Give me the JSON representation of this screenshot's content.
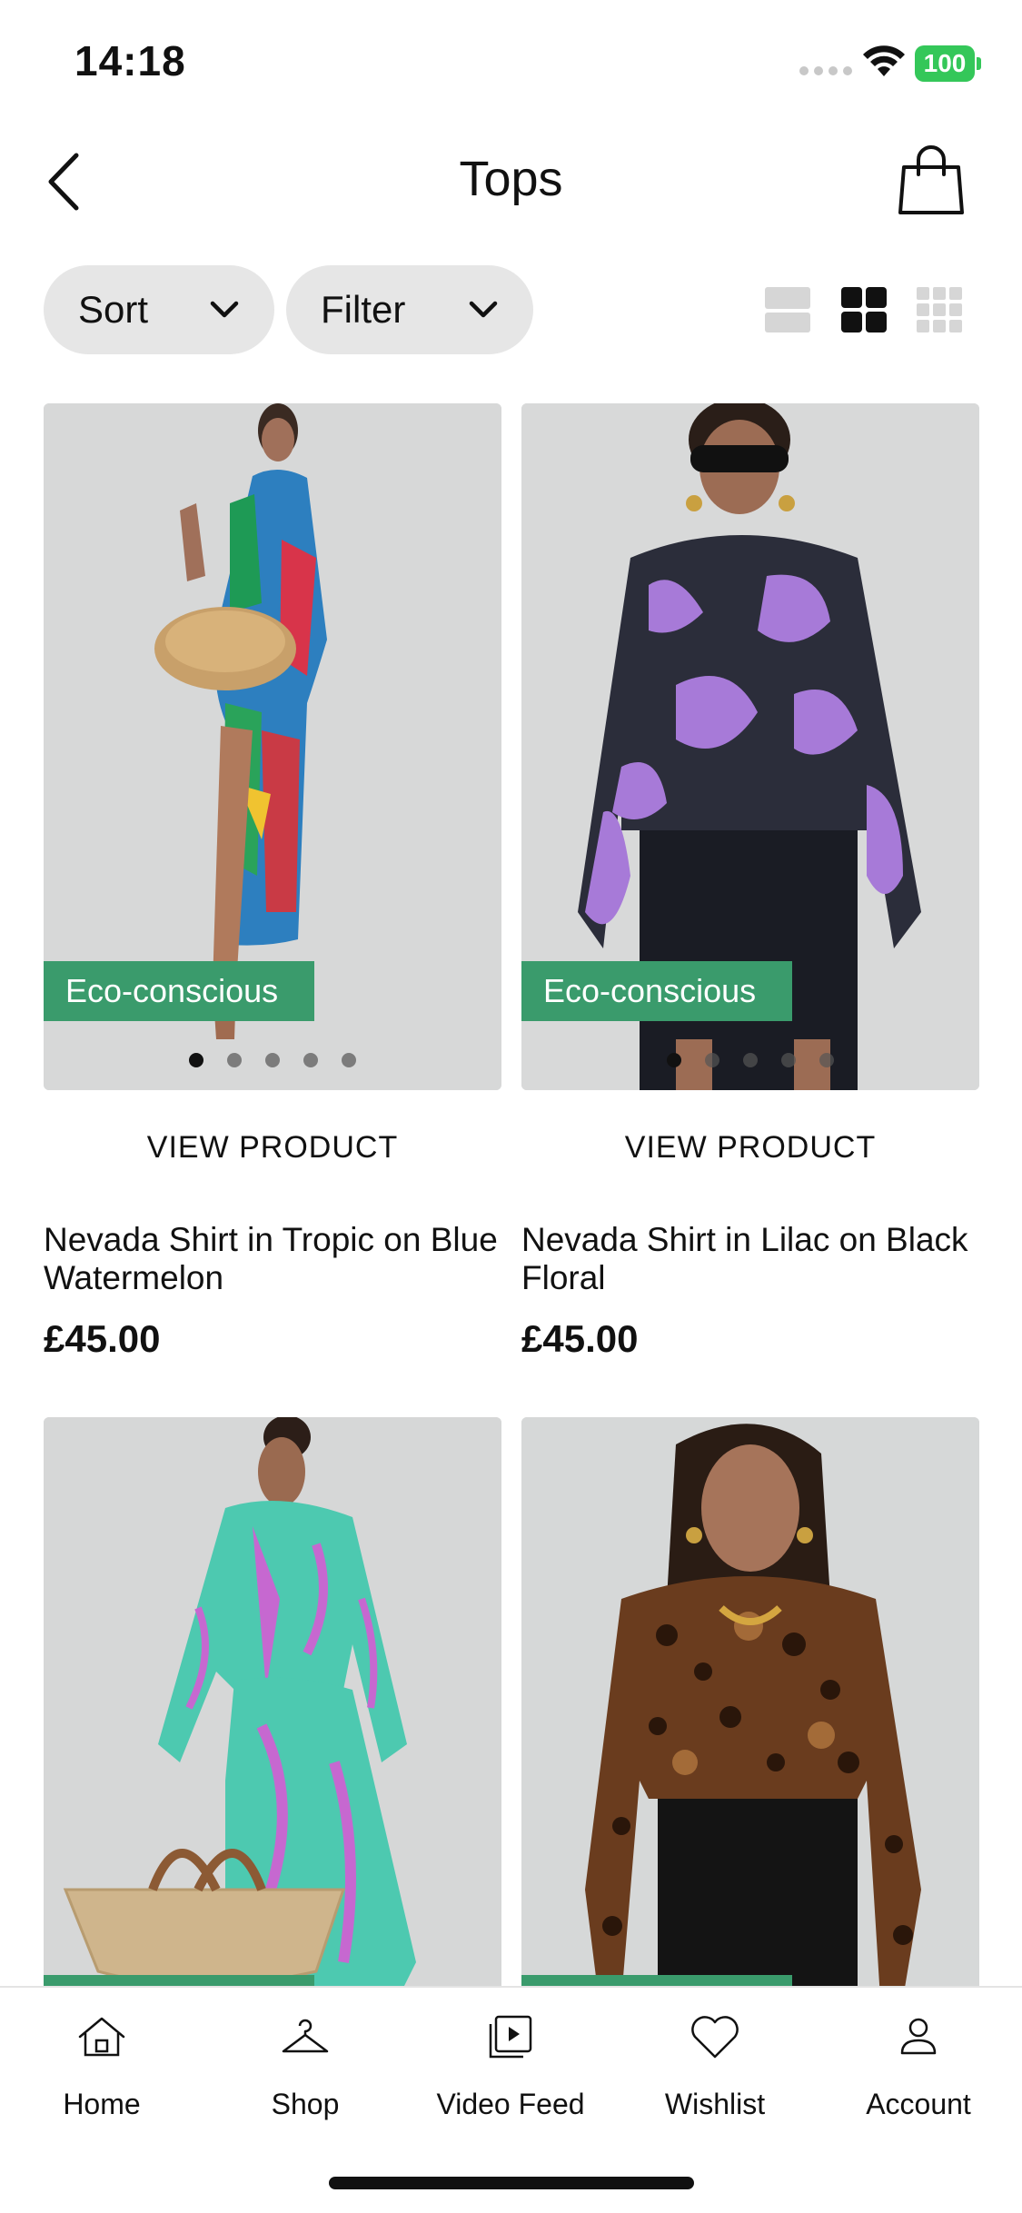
{
  "status_bar": {
    "time": "14:18",
    "battery": "100"
  },
  "header": {
    "title": "Tops"
  },
  "controls": {
    "sort_label": "Sort",
    "filter_label": "Filter"
  },
  "products": [
    {
      "badge": "Eco-conscious",
      "cta": "VIEW PRODUCT",
      "name": "Nevada Shirt in Tropic on Blue Watermelon",
      "price": "£45.00"
    },
    {
      "badge": "Eco-conscious",
      "cta": "VIEW PRODUCT",
      "name": "Nevada Shirt in Lilac on Black Floral",
      "price": "£45.00"
    },
    {
      "badge": "",
      "cta": "",
      "name": "",
      "price": ""
    },
    {
      "badge": "",
      "cta": "",
      "name": "",
      "price": ""
    }
  ],
  "nav": {
    "home": "Home",
    "shop": "Shop",
    "video_feed": "Video Feed",
    "wishlist": "Wishlist",
    "account": "Account"
  },
  "colors": {
    "eco_badge": "#3a9b6c",
    "battery": "#34c759",
    "pill_bg": "#e6e6e6"
  }
}
